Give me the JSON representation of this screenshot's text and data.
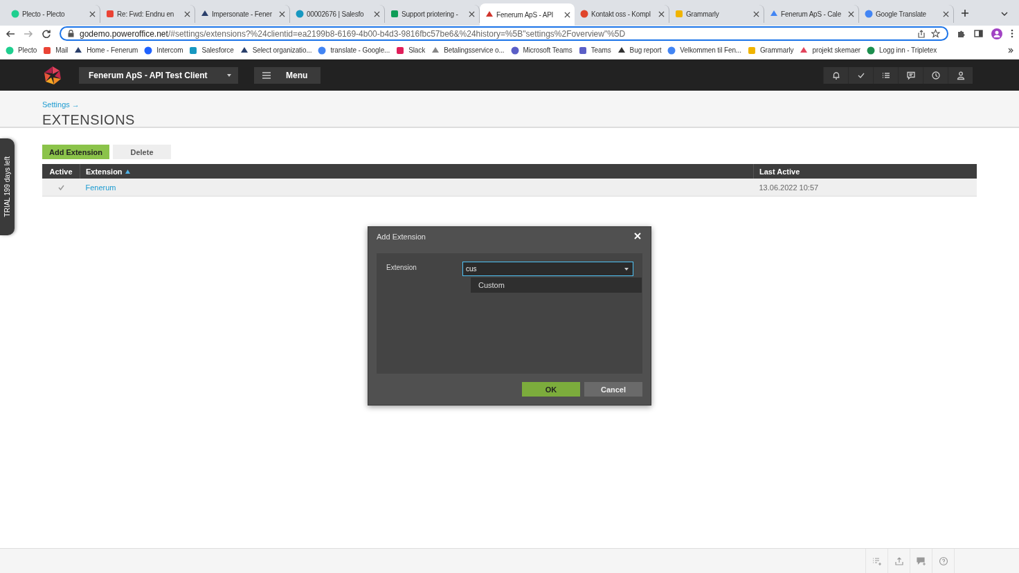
{
  "browser": {
    "tabs": [
      {
        "label": "Plecto - Plecto",
        "selected": false
      },
      {
        "label": "Re: Fwd: Endnu en",
        "selected": false
      },
      {
        "label": "Impersonate - Fener",
        "selected": false
      },
      {
        "label": "00002676 | Salesfo",
        "selected": false
      },
      {
        "label": "Support priotering -",
        "selected": false
      },
      {
        "label": "Fenerum ApS - API",
        "selected": true
      },
      {
        "label": "Kontakt oss - Kompl",
        "selected": false
      },
      {
        "label": "Grammarly",
        "selected": false
      },
      {
        "label": "Fenerum ApS - Cale",
        "selected": false
      },
      {
        "label": "Google Translate",
        "selected": false
      }
    ],
    "address_host": "godemo.poweroffice.net",
    "address_path": "/#settings/extensions?%24clientid=ea2199b8-6169-4b00-b4d3-9816fbc57be6&%24history=%5B\"settings%2Foverview\"%5D",
    "bookmarks": [
      "Plecto",
      "Mail",
      "Home - Fenerum",
      "Intercom",
      "Salesforce",
      "Select organizatio...",
      "translate - Google...",
      "Slack",
      "Betalingsservice o...",
      "Microsoft Teams",
      "Teams",
      "Bug report",
      "Velkommen til Fen...",
      "Grammarly",
      "projekt skemaer",
      "Logg inn - Tripletex"
    ]
  },
  "header": {
    "client": "Fenerum ApS - API Test Client",
    "menu": "Menu"
  },
  "breadcrumb": "Settings →",
  "title": "EXTENSIONS",
  "actions": [
    "Add Extension",
    "Delete"
  ],
  "table": {
    "columns": [
      {
        "label": "Active",
        "sorted": false
      },
      {
        "label": "Extension",
        "sorted": true
      },
      {
        "label": "Last Active",
        "sorted": false
      }
    ],
    "rows": [
      {
        "active": true,
        "extension": "Fenerum",
        "last_active": "13.06.2022 10:57"
      }
    ]
  },
  "trial": "TRIAL 199 days left",
  "dialog": {
    "title": "Add Extension",
    "field_label": "Extension",
    "value": "cus",
    "options": [
      "Custom"
    ],
    "buttons": [
      "OK",
      "Cancel"
    ]
  }
}
